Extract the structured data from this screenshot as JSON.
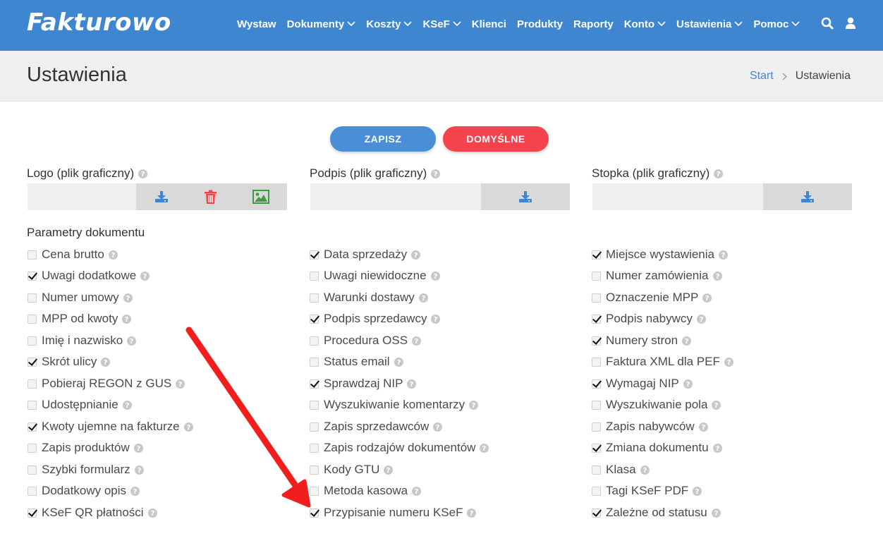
{
  "brand": {
    "logo": "Fakturowo",
    "color": "#3f86d0"
  },
  "nav": [
    {
      "label": "Wystaw",
      "dropdown": false
    },
    {
      "label": "Dokumenty",
      "dropdown": true
    },
    {
      "label": "Koszty",
      "dropdown": true
    },
    {
      "label": "KSeF",
      "dropdown": true
    },
    {
      "label": "Klienci",
      "dropdown": false
    },
    {
      "label": "Produkty",
      "dropdown": false
    },
    {
      "label": "Raporty",
      "dropdown": false
    },
    {
      "label": "Konto",
      "dropdown": true
    },
    {
      "label": "Ustawienia",
      "dropdown": true
    },
    {
      "label": "Pomoc",
      "dropdown": true
    }
  ],
  "nav_icons": [
    "search-icon",
    "user-icon"
  ],
  "page": {
    "title": "Ustawienia",
    "breadcrumb": {
      "home": "Start",
      "current": "Ustawienia"
    }
  },
  "buttons": {
    "save": "ZAPISZ",
    "default": "DOMYŚLNE",
    "save_color": "#4a8fd6",
    "default_color": "#f4434a"
  },
  "uploads": [
    {
      "label": "Logo (plik graficzny)",
      "actions": [
        "download-icon",
        "trash-icon",
        "image-icon"
      ]
    },
    {
      "label": "Podpis (plik graficzny)",
      "actions": [
        "download-icon"
      ]
    },
    {
      "label": "Stopka (plik graficzny)",
      "actions": [
        "download-icon"
      ]
    }
  ],
  "params": {
    "title": "Parametry dokumentu",
    "columns": [
      [
        {
          "label": "Cena brutto",
          "checked": false
        },
        {
          "label": "Uwagi dodatkowe",
          "checked": true
        },
        {
          "label": "Numer umowy",
          "checked": false
        },
        {
          "label": "MPP od kwoty",
          "checked": false
        },
        {
          "label": "Imię i nazwisko",
          "checked": false
        },
        {
          "label": "Skrót ulicy",
          "checked": true
        },
        {
          "label": "Pobieraj REGON z GUS",
          "checked": false
        },
        {
          "label": "Udostępnianie",
          "checked": false
        },
        {
          "label": "Kwoty ujemne na fakturze",
          "checked": true
        },
        {
          "label": "Zapis produktów",
          "checked": false
        },
        {
          "label": "Szybki formularz",
          "checked": false
        },
        {
          "label": "Dodatkowy opis",
          "checked": false
        },
        {
          "label": "KSeF QR płatności",
          "checked": true
        }
      ],
      [
        {
          "label": "Data sprzedaży",
          "checked": true
        },
        {
          "label": "Uwagi niewidoczne",
          "checked": false
        },
        {
          "label": "Warunki dostawy",
          "checked": false
        },
        {
          "label": "Podpis sprzedawcy",
          "checked": true
        },
        {
          "label": "Procedura OSS",
          "checked": false
        },
        {
          "label": "Status email",
          "checked": false
        },
        {
          "label": "Sprawdzaj NIP",
          "checked": true
        },
        {
          "label": "Wyszukiwanie komentarzy",
          "checked": false
        },
        {
          "label": "Zapis sprzedawców",
          "checked": false
        },
        {
          "label": "Zapis rodzajów dokumentów",
          "checked": false
        },
        {
          "label": "Kody GTU",
          "checked": false
        },
        {
          "label": "Metoda kasowa",
          "checked": false
        },
        {
          "label": "Przypisanie numeru KSeF",
          "checked": true
        }
      ],
      [
        {
          "label": "Miejsce wystawienia",
          "checked": true
        },
        {
          "label": "Numer zamówienia",
          "checked": false
        },
        {
          "label": "Oznaczenie MPP",
          "checked": false
        },
        {
          "label": "Podpis nabywcy",
          "checked": true
        },
        {
          "label": "Numery stron",
          "checked": true
        },
        {
          "label": "Faktura XML dla PEF",
          "checked": false
        },
        {
          "label": "Wymagaj NIP",
          "checked": true
        },
        {
          "label": "Wyszukiwanie pola",
          "checked": false
        },
        {
          "label": "Zapis nabywców",
          "checked": false
        },
        {
          "label": "Zmiana dokumentu",
          "checked": true
        },
        {
          "label": "Klasa",
          "checked": false
        },
        {
          "label": "Tagi KSeF PDF",
          "checked": false
        },
        {
          "label": "Zależne od statusu",
          "checked": true
        }
      ]
    ]
  },
  "annotation": {
    "arrow_color": "#f21d1d"
  }
}
